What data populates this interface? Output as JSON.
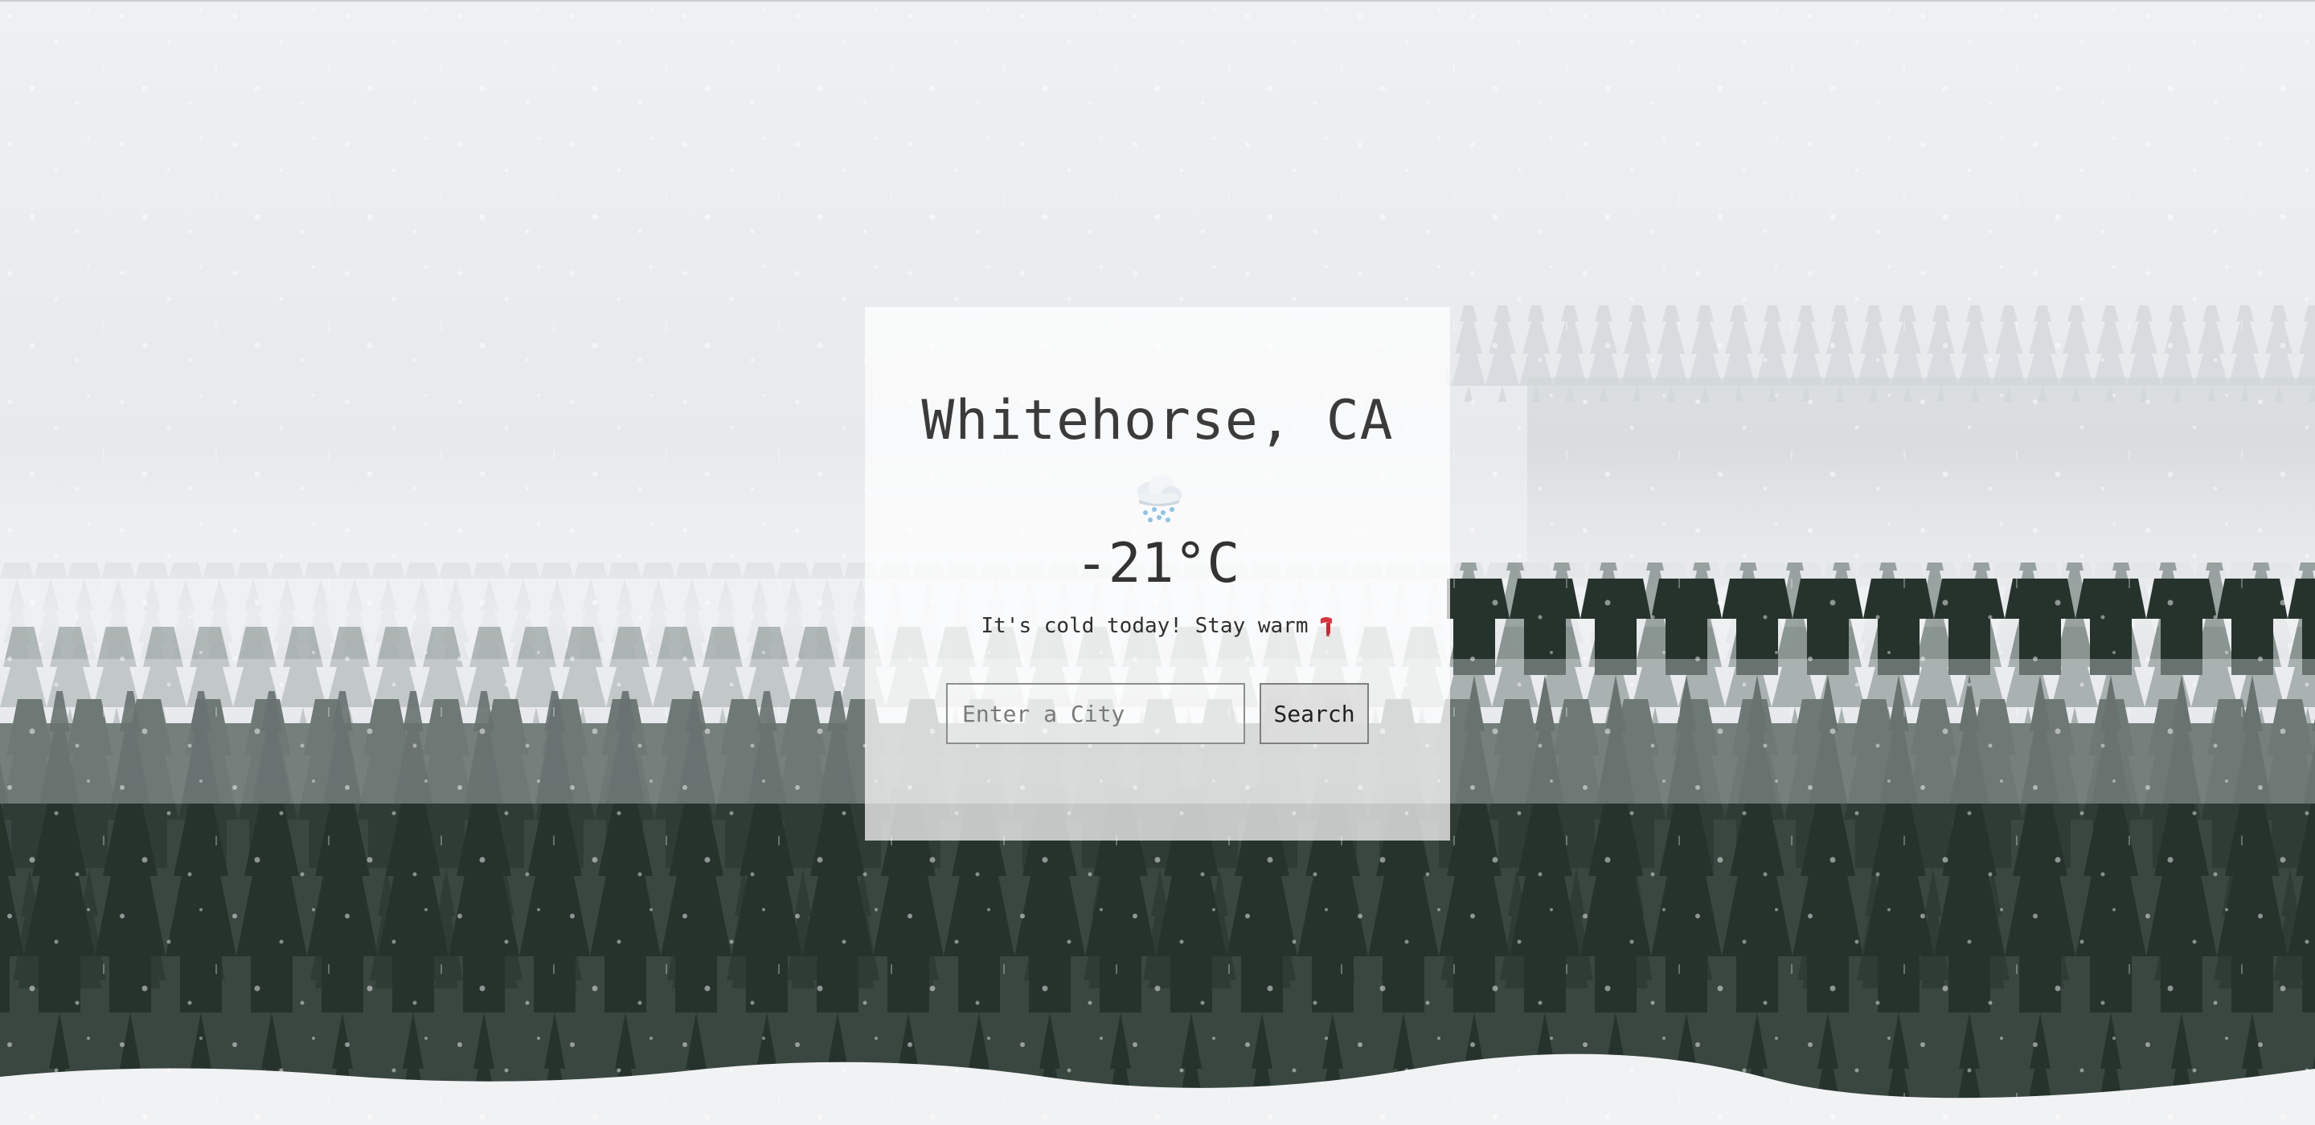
{
  "weather": {
    "city": "Whitehorse, CA",
    "temperature": "-21°C",
    "condition_icon": "snow-cloud-icon",
    "message": "It's cold today! Stay warm",
    "message_icon": "scarf-icon"
  },
  "search": {
    "placeholder": "Enter a City",
    "value": "",
    "button_label": "Search"
  },
  "background": {
    "image": "snowy-forest-photo",
    "colors": {
      "sky": "#eceef1",
      "fog": "#e3e6ea",
      "tree_dark": "#2c3a32",
      "snow": "#f3f4f5"
    }
  }
}
